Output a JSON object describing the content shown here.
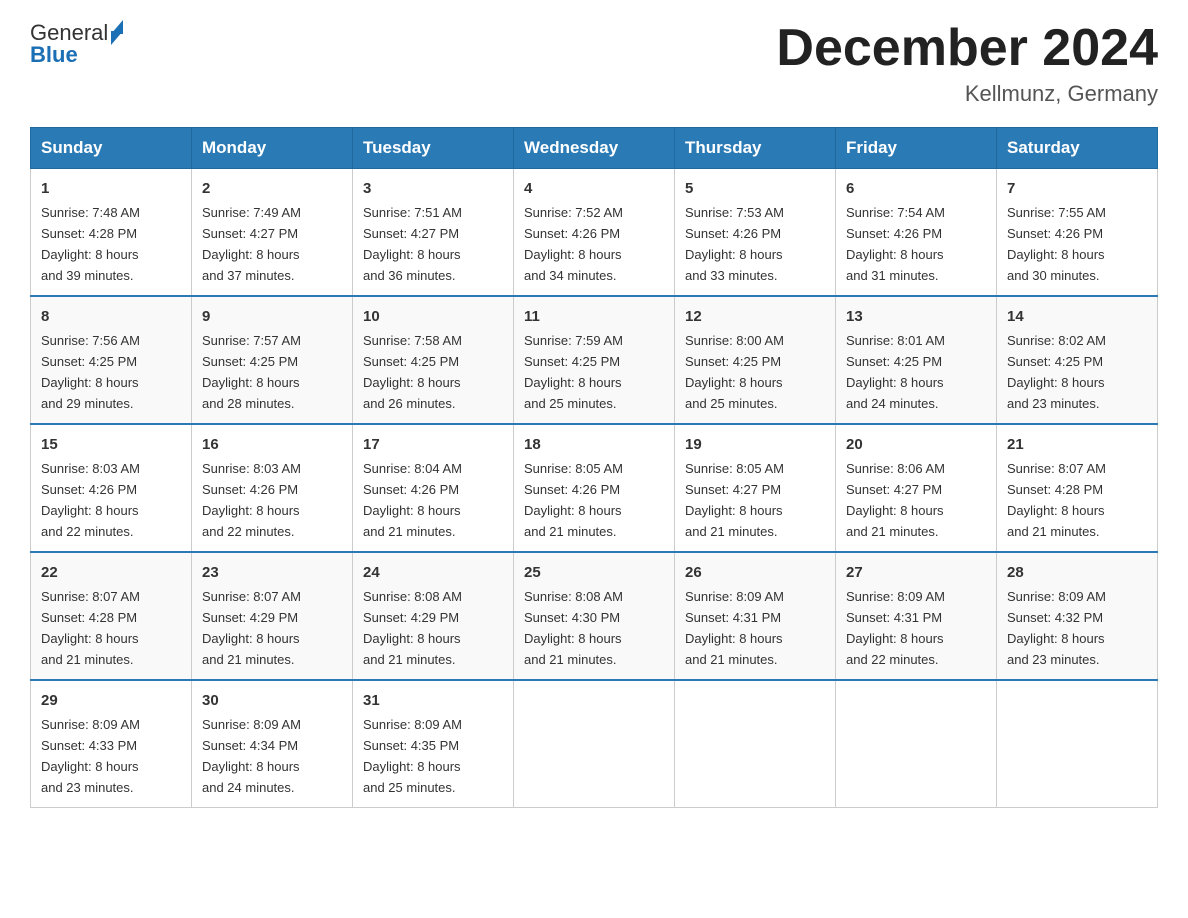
{
  "header": {
    "logo_text": "General",
    "logo_blue": "Blue",
    "month_title": "December 2024",
    "location": "Kellmunz, Germany"
  },
  "days_of_week": [
    "Sunday",
    "Monday",
    "Tuesday",
    "Wednesday",
    "Thursday",
    "Friday",
    "Saturday"
  ],
  "weeks": [
    [
      {
        "day": "1",
        "sunrise": "7:48 AM",
        "sunset": "4:28 PM",
        "daylight": "8 hours and 39 minutes."
      },
      {
        "day": "2",
        "sunrise": "7:49 AM",
        "sunset": "4:27 PM",
        "daylight": "8 hours and 37 minutes."
      },
      {
        "day": "3",
        "sunrise": "7:51 AM",
        "sunset": "4:27 PM",
        "daylight": "8 hours and 36 minutes."
      },
      {
        "day": "4",
        "sunrise": "7:52 AM",
        "sunset": "4:26 PM",
        "daylight": "8 hours and 34 minutes."
      },
      {
        "day": "5",
        "sunrise": "7:53 AM",
        "sunset": "4:26 PM",
        "daylight": "8 hours and 33 minutes."
      },
      {
        "day": "6",
        "sunrise": "7:54 AM",
        "sunset": "4:26 PM",
        "daylight": "8 hours and 31 minutes."
      },
      {
        "day": "7",
        "sunrise": "7:55 AM",
        "sunset": "4:26 PM",
        "daylight": "8 hours and 30 minutes."
      }
    ],
    [
      {
        "day": "8",
        "sunrise": "7:56 AM",
        "sunset": "4:25 PM",
        "daylight": "8 hours and 29 minutes."
      },
      {
        "day": "9",
        "sunrise": "7:57 AM",
        "sunset": "4:25 PM",
        "daylight": "8 hours and 28 minutes."
      },
      {
        "day": "10",
        "sunrise": "7:58 AM",
        "sunset": "4:25 PM",
        "daylight": "8 hours and 26 minutes."
      },
      {
        "day": "11",
        "sunrise": "7:59 AM",
        "sunset": "4:25 PM",
        "daylight": "8 hours and 25 minutes."
      },
      {
        "day": "12",
        "sunrise": "8:00 AM",
        "sunset": "4:25 PM",
        "daylight": "8 hours and 25 minutes."
      },
      {
        "day": "13",
        "sunrise": "8:01 AM",
        "sunset": "4:25 PM",
        "daylight": "8 hours and 24 minutes."
      },
      {
        "day": "14",
        "sunrise": "8:02 AM",
        "sunset": "4:25 PM",
        "daylight": "8 hours and 23 minutes."
      }
    ],
    [
      {
        "day": "15",
        "sunrise": "8:03 AM",
        "sunset": "4:26 PM",
        "daylight": "8 hours and 22 minutes."
      },
      {
        "day": "16",
        "sunrise": "8:03 AM",
        "sunset": "4:26 PM",
        "daylight": "8 hours and 22 minutes."
      },
      {
        "day": "17",
        "sunrise": "8:04 AM",
        "sunset": "4:26 PM",
        "daylight": "8 hours and 21 minutes."
      },
      {
        "day": "18",
        "sunrise": "8:05 AM",
        "sunset": "4:26 PM",
        "daylight": "8 hours and 21 minutes."
      },
      {
        "day": "19",
        "sunrise": "8:05 AM",
        "sunset": "4:27 PM",
        "daylight": "8 hours and 21 minutes."
      },
      {
        "day": "20",
        "sunrise": "8:06 AM",
        "sunset": "4:27 PM",
        "daylight": "8 hours and 21 minutes."
      },
      {
        "day": "21",
        "sunrise": "8:07 AM",
        "sunset": "4:28 PM",
        "daylight": "8 hours and 21 minutes."
      }
    ],
    [
      {
        "day": "22",
        "sunrise": "8:07 AM",
        "sunset": "4:28 PM",
        "daylight": "8 hours and 21 minutes."
      },
      {
        "day": "23",
        "sunrise": "8:07 AM",
        "sunset": "4:29 PM",
        "daylight": "8 hours and 21 minutes."
      },
      {
        "day": "24",
        "sunrise": "8:08 AM",
        "sunset": "4:29 PM",
        "daylight": "8 hours and 21 minutes."
      },
      {
        "day": "25",
        "sunrise": "8:08 AM",
        "sunset": "4:30 PM",
        "daylight": "8 hours and 21 minutes."
      },
      {
        "day": "26",
        "sunrise": "8:09 AM",
        "sunset": "4:31 PM",
        "daylight": "8 hours and 21 minutes."
      },
      {
        "day": "27",
        "sunrise": "8:09 AM",
        "sunset": "4:31 PM",
        "daylight": "8 hours and 22 minutes."
      },
      {
        "day": "28",
        "sunrise": "8:09 AM",
        "sunset": "4:32 PM",
        "daylight": "8 hours and 23 minutes."
      }
    ],
    [
      {
        "day": "29",
        "sunrise": "8:09 AM",
        "sunset": "4:33 PM",
        "daylight": "8 hours and 23 minutes."
      },
      {
        "day": "30",
        "sunrise": "8:09 AM",
        "sunset": "4:34 PM",
        "daylight": "8 hours and 24 minutes."
      },
      {
        "day": "31",
        "sunrise": "8:09 AM",
        "sunset": "4:35 PM",
        "daylight": "8 hours and 25 minutes."
      },
      null,
      null,
      null,
      null
    ]
  ],
  "labels": {
    "sunrise_prefix": "Sunrise: ",
    "sunset_prefix": "Sunset: ",
    "daylight_prefix": "Daylight: "
  }
}
